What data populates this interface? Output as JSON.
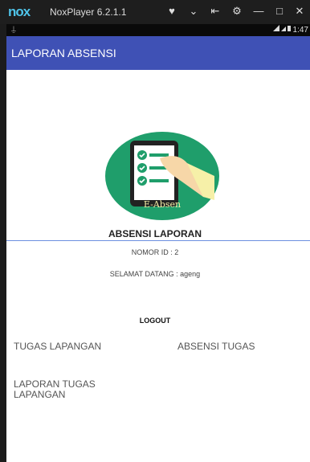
{
  "emulator": {
    "logo": "nox",
    "title": "NoxPlayer 6.2.1.1",
    "controls": [
      "♥",
      "⌄",
      "⇤",
      "⚙",
      "—",
      "□",
      "✕"
    ]
  },
  "status": {
    "left_icon": "⍊",
    "time": "1:47"
  },
  "app": {
    "title": "LAPORAN ABSENSI"
  },
  "logo": {
    "label": "E-Absen",
    "colors": {
      "circle": "#1f9e6b",
      "phone": "#222222",
      "check": "#ffffff"
    }
  },
  "main": {
    "heading": "ABSENSI LAPORAN",
    "nomor_id": "NOMOR ID : 2",
    "welcome": "SELAMAT DATANG : ageng",
    "logout": "LOGOUT",
    "menu": {
      "tugas_lapangan": "TUGAS LAPANGAN",
      "absensi_tugas": "ABSENSI TUGAS",
      "laporan_tugas_lapangan": "LAPORAN TUGAS LAPANGAN"
    }
  }
}
